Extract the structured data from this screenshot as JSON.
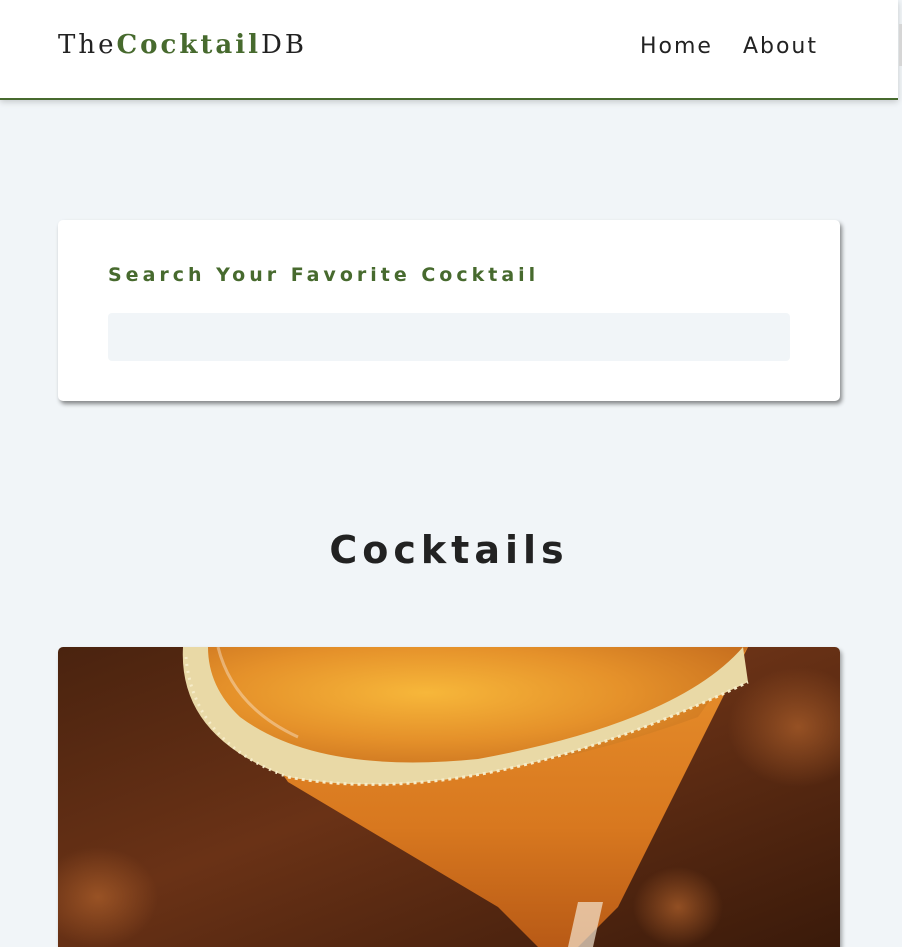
{
  "navbar": {
    "logo": {
      "prefix": "The",
      "accent": "Cocktail",
      "suffix": "DB"
    },
    "links": [
      {
        "label": "Home"
      },
      {
        "label": "About"
      }
    ]
  },
  "search": {
    "label": "Search Your Favorite Cocktail",
    "value": ""
  },
  "main": {
    "title": "Cocktails"
  },
  "colors": {
    "accent": "#476a2e",
    "background": "#f1f5f8",
    "text": "#222222",
    "card": "#ffffff"
  }
}
